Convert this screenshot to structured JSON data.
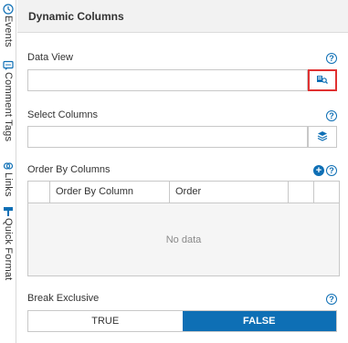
{
  "side_tabs": [
    {
      "label": "Events",
      "icon": "events-icon"
    },
    {
      "label": "Comment Tags",
      "icon": "comment-tags-icon"
    },
    {
      "label": "Links",
      "icon": "links-icon"
    },
    {
      "label": "Quick Format",
      "icon": "quick-format-icon"
    }
  ],
  "header": {
    "title": "Dynamic Columns"
  },
  "data_view": {
    "label": "Data View",
    "value": "",
    "help": "?",
    "button_icon": "data-view-search-icon"
  },
  "select_columns": {
    "label": "Select Columns",
    "value": "",
    "help": "?",
    "button_icon": "layers-icon"
  },
  "order_by": {
    "label": "Order By Columns",
    "help": "?",
    "add": "+",
    "columns": [
      "Order By Column",
      "Order"
    ],
    "empty_text": "No data"
  },
  "break_exclusive": {
    "label": "Break Exclusive",
    "help": "?",
    "options": [
      "TRUE",
      "FALSE"
    ],
    "selected": "FALSE"
  },
  "colors": {
    "accent": "#0e6fb5",
    "highlight": "#e03131",
    "header_bg": "#f2f2f2"
  }
}
